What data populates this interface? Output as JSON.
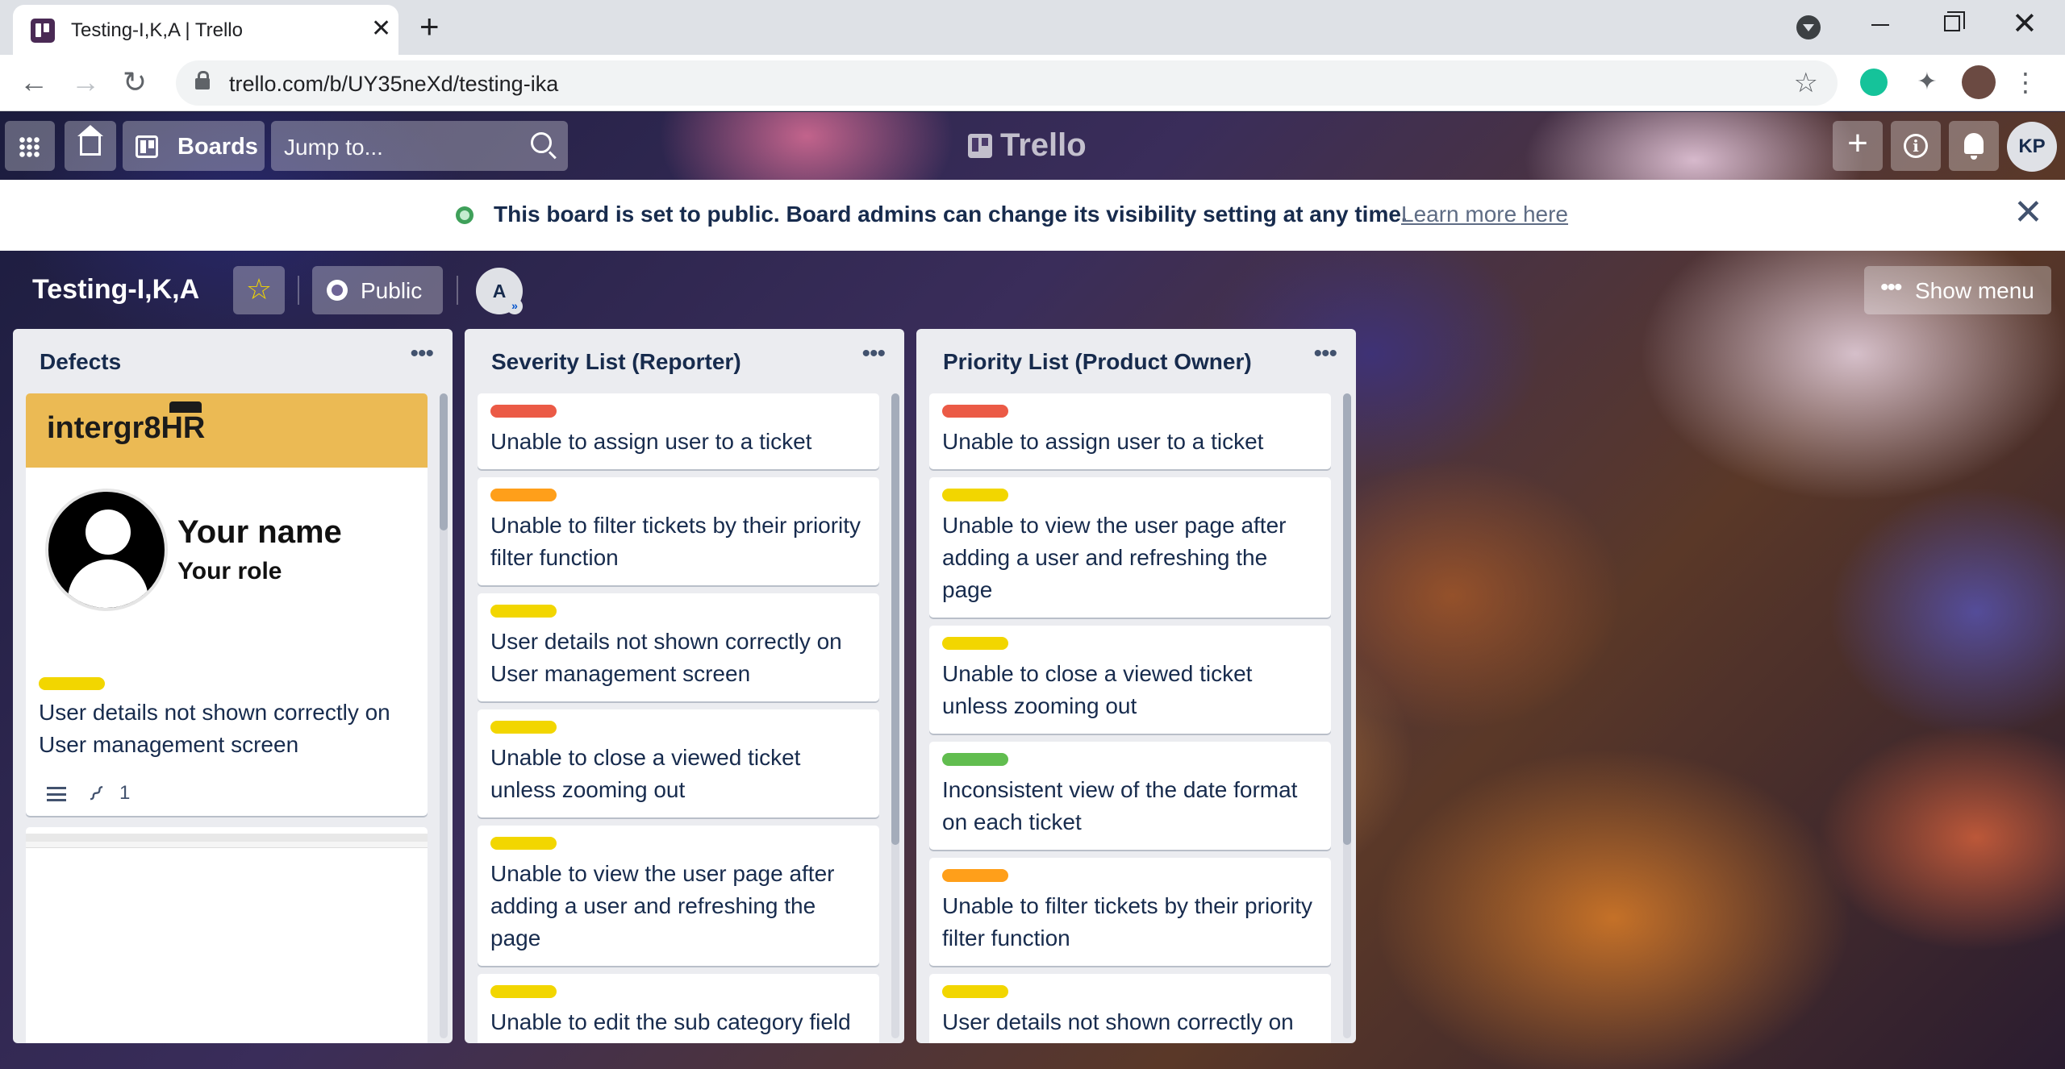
{
  "browser": {
    "tab_title": "Testing-I,K,A | Trello",
    "url": "trello.com/b/UY35neXd/testing-ika"
  },
  "header": {
    "boards_label": "Boards",
    "jump_placeholder": "Jump to...",
    "logo_text": "Trello",
    "avatar_initials": "KP"
  },
  "banner": {
    "message": "This board is set to public. Board admins can change its visibility setting at any time.",
    "link": "Learn more here"
  },
  "board": {
    "title": "Testing-I,K,A",
    "visibility": "Public",
    "member_initial": "A",
    "show_menu": "Show menu"
  },
  "colors": {
    "red": "#eb5a46",
    "orange": "#ff9f1a",
    "yellow": "#f2d600",
    "green": "#61bd4f"
  },
  "lists": [
    {
      "title": "Defects",
      "cover_card": {
        "logo": "intergr8HR",
        "name": "Your name",
        "role": "Your role",
        "label": "yellow",
        "text": "User details not shown correctly on User management screen",
        "attachments": "1"
      }
    },
    {
      "title": "Severity List (Reporter)",
      "cards": [
        {
          "label": "red",
          "text": "Unable to assign user to a ticket"
        },
        {
          "label": "orange",
          "text": "Unable to filter tickets by their priority filter function"
        },
        {
          "label": "yellow",
          "text": "User details not shown correctly on User management screen"
        },
        {
          "label": "yellow",
          "text": "Unable to close a viewed ticket unless zooming out"
        },
        {
          "label": "yellow",
          "text": "Unable to view the user page after adding a user and refreshing the page"
        },
        {
          "label": "yellow",
          "text": "Unable to edit the sub category field"
        }
      ]
    },
    {
      "title": "Priority List (Product Owner)",
      "cards": [
        {
          "label": "red",
          "text": "Unable to assign user to a ticket"
        },
        {
          "label": "yellow",
          "text": "Unable to view the user page after adding a user and refreshing the page"
        },
        {
          "label": "yellow",
          "text": "Unable to close a viewed ticket unless zooming out"
        },
        {
          "label": "green",
          "text": "Inconsistent view of the date format on each ticket"
        },
        {
          "label": "orange",
          "text": "Unable to filter tickets by their priority filter function"
        },
        {
          "label": "yellow",
          "text": "User details not shown correctly on"
        }
      ]
    }
  ]
}
